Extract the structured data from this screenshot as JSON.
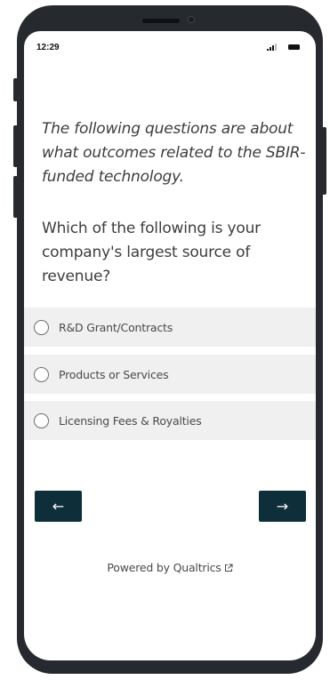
{
  "status_bar": {
    "time": "12:29"
  },
  "survey": {
    "intro": "The following questions are about what outcomes related to the SBIR-funded technology.",
    "question": "Which of the following is your company's largest source of revenue?",
    "choices": [
      {
        "label": "R&D Grant/Contracts"
      },
      {
        "label": "Products or Services"
      },
      {
        "label": "Licensing Fees & Royalties"
      }
    ]
  },
  "navigation": {
    "back_label": "←",
    "next_label": "→"
  },
  "footer": {
    "powered_by": "Powered by Qualtrics"
  },
  "colors": {
    "button_bg": "#0e2f3a",
    "choice_bg": "#f0f0f0",
    "phone_frame": "#262a2f"
  }
}
